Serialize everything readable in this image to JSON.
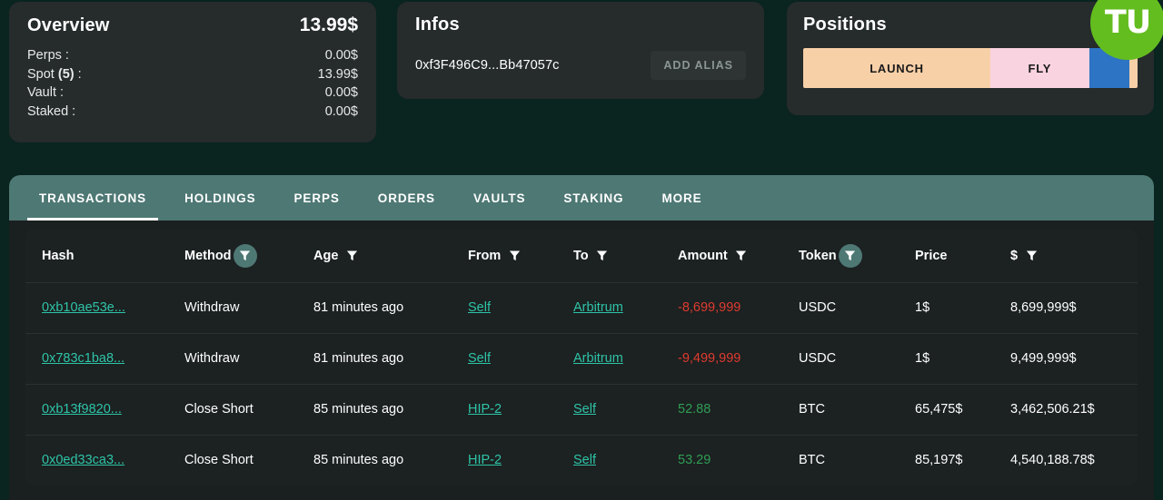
{
  "overview": {
    "title": "Overview",
    "total": "13.99$",
    "rows": [
      {
        "label": "Perps :",
        "value": "0.00$"
      },
      {
        "label_pre": "Spot ",
        "label_bold": "(5)",
        "label_post": " :",
        "value": "13.99$"
      },
      {
        "label": "Vault :",
        "value": "0.00$"
      },
      {
        "label": "Staked :",
        "value": "0.00$"
      }
    ]
  },
  "infos": {
    "title": "Infos",
    "address": "0xf3F496C9...Bb47057c",
    "add_alias_label": "ADD ALIAS"
  },
  "positions": {
    "title": "Positions",
    "badge_label": "TU",
    "badge_color": "#63bd1f",
    "segments": [
      {
        "label": "LAUNCH",
        "color": "#f8d0a8",
        "width_pct": 56
      },
      {
        "label": "FLY",
        "color": "#fad3e0",
        "width_pct": 29.5
      },
      {
        "label": "",
        "color": "#2d74c4",
        "width_pct": 12
      },
      {
        "label": "",
        "color": "#f8d0a8",
        "width_pct": 2.5
      }
    ]
  },
  "tabs": [
    {
      "label": "TRANSACTIONS",
      "active": true
    },
    {
      "label": "HOLDINGS",
      "active": false
    },
    {
      "label": "PERPS",
      "active": false
    },
    {
      "label": "ORDERS",
      "active": false
    },
    {
      "label": "VAULTS",
      "active": false
    },
    {
      "label": "STAKING",
      "active": false
    },
    {
      "label": "MORE",
      "active": false
    }
  ],
  "table": {
    "columns": [
      {
        "label": "Hash",
        "filter": "none",
        "key": "hash"
      },
      {
        "label": "Method",
        "filter": "active",
        "key": "method"
      },
      {
        "label": "Age",
        "filter": "plain",
        "key": "age"
      },
      {
        "label": "From",
        "filter": "plain",
        "key": "from"
      },
      {
        "label": "To",
        "filter": "plain",
        "key": "to"
      },
      {
        "label": "Amount",
        "filter": "plain",
        "key": "amount"
      },
      {
        "label": "Token",
        "filter": "active",
        "key": "token"
      },
      {
        "label": "Price",
        "filter": "none",
        "key": "price"
      },
      {
        "label": "$",
        "filter": "plain",
        "key": "usd"
      }
    ],
    "rows": [
      {
        "hash": "0xb10ae53e...",
        "method": "Withdraw",
        "age": "81 minutes ago",
        "from": "Self",
        "to": "Arbitrum",
        "amount": "-8,699,999",
        "amount_sign": "neg",
        "token": "USDC",
        "price": "1$",
        "usd": "8,699,999$"
      },
      {
        "hash": "0x783c1ba8...",
        "method": "Withdraw",
        "age": "81 minutes ago",
        "from": "Self",
        "to": "Arbitrum",
        "amount": "-9,499,999",
        "amount_sign": "neg",
        "token": "USDC",
        "price": "1$",
        "usd": "9,499,999$"
      },
      {
        "hash": "0xb13f9820...",
        "method": "Close Short",
        "age": "85 minutes ago",
        "from": "HIP-2",
        "to": "Self",
        "amount": "52.88",
        "amount_sign": "pos",
        "token": "BTC",
        "price": "65,475$",
        "usd": "3,462,506.21$"
      },
      {
        "hash": "0x0ed33ca3...",
        "method": "Close Short",
        "age": "85 minutes ago",
        "from": "HIP-2",
        "to": "Self",
        "amount": "53.29",
        "amount_sign": "pos",
        "token": "BTC",
        "price": "85,197$",
        "usd": "4,540,188.78$"
      }
    ]
  },
  "colors": {
    "page_bg": "#0a2420",
    "card_bg": "#262b2b",
    "tabs_bg": "#4e7874",
    "panel_bg": "#1a1f1f",
    "link": "#2ec4a8",
    "negative": "#e03b2f",
    "positive": "#2f9e55"
  }
}
